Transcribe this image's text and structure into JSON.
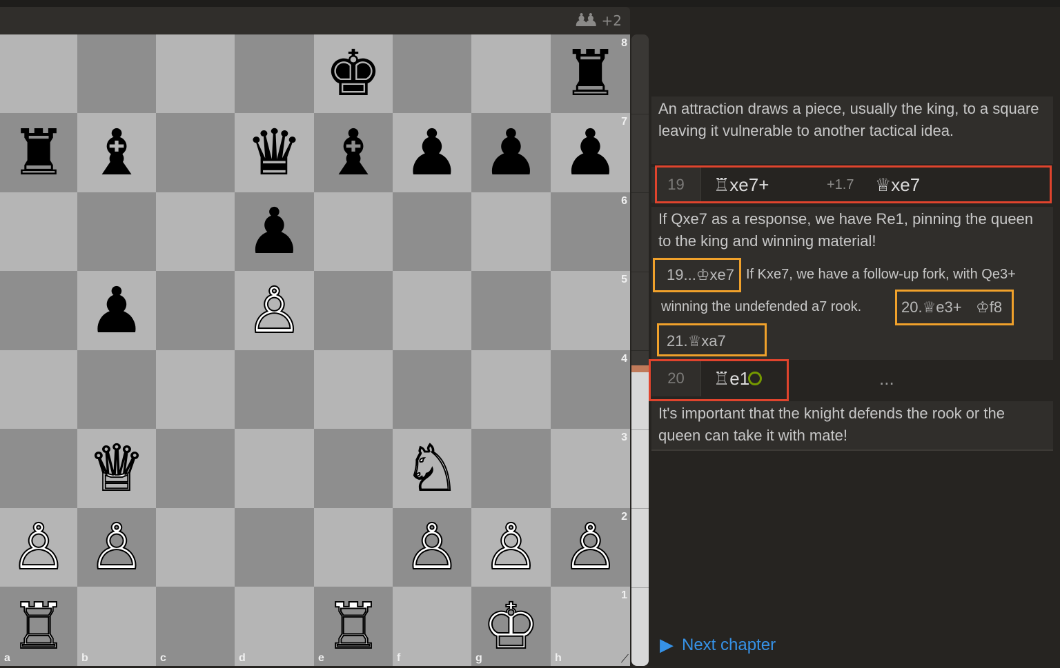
{
  "material": {
    "pawn_glyph": "♟♟",
    "diff": "+2"
  },
  "board": {
    "ranks": [
      "8",
      "7",
      "6",
      "5",
      "4",
      "3",
      "2",
      "1"
    ],
    "files": [
      "a",
      "b",
      "c",
      "d",
      "e",
      "f",
      "g",
      "h"
    ],
    "rows": [
      [
        "",
        "",
        "",
        "",
        "♚",
        "",
        "",
        "♜"
      ],
      [
        "♜",
        "♝",
        "",
        "♛",
        "♝",
        "♟",
        "♟",
        "♟"
      ],
      [
        "",
        "",
        "",
        "♟",
        "",
        "",
        "",
        ""
      ],
      [
        "",
        "♟",
        "",
        "♙",
        "",
        "",
        "",
        ""
      ],
      [
        "",
        "",
        "",
        "",
        "",
        "",
        "",
        ""
      ],
      [
        "",
        "♕",
        "",
        "",
        "",
        "♘",
        "",
        ""
      ],
      [
        "♙",
        "♙",
        "",
        "",
        "",
        "♙",
        "♙",
        "♙"
      ],
      [
        "♖",
        "",
        "",
        "",
        "♖",
        "",
        "♔",
        ""
      ]
    ],
    "resize_glyph": "⟋"
  },
  "gauge": {
    "white_fraction": 0.47
  },
  "analysis": {
    "intro_comment": "An attraction draws a piece, usually the king, to a square leaving it vulnerable to another tactical idea.",
    "move19": {
      "index": "19",
      "white": "♖xe7+",
      "eval": "+1.7",
      "black": "♕xe7"
    },
    "comment_after_19": "If Qxe7 as a response, we have Re1, pinning the queen to the king and winning material!",
    "variation": {
      "move_a": "19...♔xe7",
      "text_a": "If Kxe7, we have a follow-up fork, with Qe3+",
      "text_b": "winning the undefended a7 rook.",
      "move_b": "20.♕e3+",
      "move_c": "♔f8",
      "move_d": "21.♕xa7"
    },
    "move20": {
      "index": "20",
      "white": "♖e1",
      "black": "..."
    },
    "comment_after_20": "It's important that the knight defends the rook or the queen can take it with mate!"
  },
  "next_chapter": {
    "label": "Next chapter",
    "icon": "▶"
  }
}
